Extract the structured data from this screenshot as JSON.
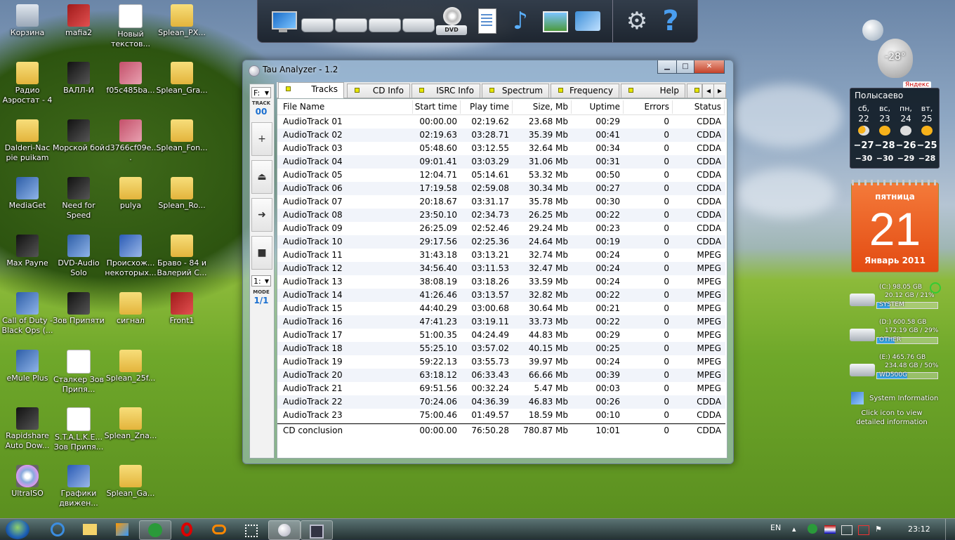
{
  "desktop": {
    "icons": [
      {
        "label": "Корзина",
        "kind": "bin"
      },
      {
        "label": "mafia2",
        "kind": "red"
      },
      {
        "label": "Новый текстов...",
        "kind": "doc"
      },
      {
        "label": "Splean_PX...",
        "kind": "folder"
      },
      {
        "label": "Радио Аэростат - 4",
        "kind": "folder"
      },
      {
        "label": "ВАЛЛ-И",
        "kind": "dark"
      },
      {
        "label": "f05c485ba...",
        "kind": "img"
      },
      {
        "label": "Splean_Gra...",
        "kind": "folder"
      },
      {
        "label": "Dalderi-Nac pie puikam",
        "kind": "folder"
      },
      {
        "label": "Морской бой",
        "kind": "dark"
      },
      {
        "label": "d3766cf09e...",
        "kind": "img"
      },
      {
        "label": "Splean_Fon...",
        "kind": "folder"
      },
      {
        "label": "MediaGet",
        "kind": "exe"
      },
      {
        "label": "Need for Speed",
        "kind": "dark"
      },
      {
        "label": "pulya",
        "kind": "folder"
      },
      {
        "label": "Splean_Ro...",
        "kind": "folder"
      },
      {
        "label": "Max Payne",
        "kind": "dark"
      },
      {
        "label": "DVD-Audio Solo",
        "kind": "exe"
      },
      {
        "label": "Происхож... некоторых...",
        "kind": "word"
      },
      {
        "label": "Браво - 84 и Валерий С...",
        "kind": "folder"
      },
      {
        "label": "Call of Duty - Black Ops (...",
        "kind": "exe"
      },
      {
        "label": "Зов Припяти",
        "kind": "dark"
      },
      {
        "label": "сигнал",
        "kind": "folder"
      },
      {
        "label": "Front1",
        "kind": "red"
      },
      {
        "label": "eMule Plus",
        "kind": "exe"
      },
      {
        "label": "Сталкер Зов Припя...",
        "kind": "doc"
      },
      {
        "label": "Splean_25f...",
        "kind": "folder"
      },
      {
        "label": "",
        "kind": "none"
      },
      {
        "label": "Rapidshare Auto Dow...",
        "kind": "dark"
      },
      {
        "label": "S.T.A.L.K.E... Зов Припя...",
        "kind": "doc"
      },
      {
        "label": "Splean_Zna...",
        "kind": "folder"
      },
      {
        "label": "",
        "kind": "none"
      },
      {
        "label": "UltraISO",
        "kind": "disc"
      },
      {
        "label": "Графики движен...",
        "kind": "word"
      },
      {
        "label": "Splean_Ga...",
        "kind": "folder"
      }
    ]
  },
  "toolbar": {
    "icons": [
      "monitor-icon",
      "drive-icon",
      "drive-icon",
      "drive-icon",
      "drive-icon",
      "dvd-drive-icon",
      "document-icon",
      "music-note-icon",
      "picture-icon",
      "network-icon",
      "gear-icon",
      "help-icon"
    ],
    "dvd_label": "DVD",
    "help_label": "?"
  },
  "window": {
    "title": "Tau Analyzer - 1.2",
    "controls": {
      "minimize": "▁",
      "maximize": "□",
      "close": "✕"
    },
    "side": {
      "drive_select": "F:",
      "track_label": "TRACK",
      "track_value": "00",
      "buttons": [
        "+",
        "⏏",
        "➜",
        "■"
      ],
      "mode_select": "1:",
      "mode_label": "MODE",
      "mode_value": "1/1"
    },
    "tabs": [
      "Tracks",
      "CD Info",
      "ISRC Info",
      "Spectrum",
      "Frequency",
      "Help"
    ],
    "tab_scroll": {
      "left": "◂",
      "right": "▸"
    },
    "columns": [
      "File Name",
      "Start time",
      "Play time",
      "Size, Mb",
      "Uptime",
      "Errors",
      "Status"
    ],
    "rows": [
      [
        "AudioTrack 01",
        "00:00.00",
        "02:19.62",
        "23.68 Mb",
        "00:29",
        "0",
        "CDDA"
      ],
      [
        "AudioTrack 02",
        "02:19.63",
        "03:28.71",
        "35.39 Mb",
        "00:41",
        "0",
        "CDDA"
      ],
      [
        "AudioTrack 03",
        "05:48.60",
        "03:12.55",
        "32.64 Mb",
        "00:34",
        "0",
        "CDDA"
      ],
      [
        "AudioTrack 04",
        "09:01.41",
        "03:03.29",
        "31.06 Mb",
        "00:31",
        "0",
        "CDDA"
      ],
      [
        "AudioTrack 05",
        "12:04.71",
        "05:14.61",
        "53.32 Mb",
        "00:50",
        "0",
        "CDDA"
      ],
      [
        "AudioTrack 06",
        "17:19.58",
        "02:59.08",
        "30.34 Mb",
        "00:27",
        "0",
        "CDDA"
      ],
      [
        "AudioTrack 07",
        "20:18.67",
        "03:31.17",
        "35.78 Mb",
        "00:30",
        "0",
        "CDDA"
      ],
      [
        "AudioTrack 08",
        "23:50.10",
        "02:34.73",
        "26.25 Mb",
        "00:22",
        "0",
        "CDDA"
      ],
      [
        "AudioTrack 09",
        "26:25.09",
        "02:52.46",
        "29.24 Mb",
        "00:23",
        "0",
        "CDDA"
      ],
      [
        "AudioTrack 10",
        "29:17.56",
        "02:25.36",
        "24.64 Mb",
        "00:19",
        "0",
        "CDDA"
      ],
      [
        "AudioTrack 11",
        "31:43.18",
        "03:13.21",
        "32.74 Mb",
        "00:24",
        "0",
        "MPEG"
      ],
      [
        "AudioTrack 12",
        "34:56.40",
        "03:11.53",
        "32.47 Mb",
        "00:24",
        "0",
        "MPEG"
      ],
      [
        "AudioTrack 13",
        "38:08.19",
        "03:18.26",
        "33.59 Mb",
        "00:24",
        "0",
        "MPEG"
      ],
      [
        "AudioTrack 14",
        "41:26.46",
        "03:13.57",
        "32.82 Mb",
        "00:22",
        "0",
        "MPEG"
      ],
      [
        "AudioTrack 15",
        "44:40.29",
        "03:00.68",
        "30.64 Mb",
        "00:21",
        "0",
        "MPEG"
      ],
      [
        "AudioTrack 16",
        "47:41.23",
        "03:19.11",
        "33.73 Mb",
        "00:22",
        "0",
        "MPEG"
      ],
      [
        "AudioTrack 17",
        "51:00.35",
        "04:24.49",
        "44.83 Mb",
        "00:29",
        "0",
        "MPEG"
      ],
      [
        "AudioTrack 18",
        "55:25.10",
        "03:57.02",
        "40.15 Mb",
        "00:25",
        "0",
        "MPEG"
      ],
      [
        "AudioTrack 19",
        "59:22.13",
        "03:55.73",
        "39.97 Mb",
        "00:24",
        "0",
        "MPEG"
      ],
      [
        "AudioTrack 20",
        "63:18.12",
        "06:33.43",
        "66.66 Mb",
        "00:39",
        "0",
        "MPEG"
      ],
      [
        "AudioTrack 21",
        "69:51.56",
        "00:32.24",
        "5.47 Mb",
        "00:03",
        "0",
        "MPEG"
      ],
      [
        "AudioTrack 22",
        "70:24.06",
        "04:36.39",
        "46.83 Mb",
        "00:26",
        "0",
        "CDDA"
      ],
      [
        "AudioTrack 23",
        "75:00.46",
        "01:49.57",
        "18.59 Mb",
        "00:10",
        "0",
        "CDDA"
      ]
    ],
    "summary": [
      "CD conclusion",
      "00:00.00",
      "76:50.28",
      "780.87 Mb",
      "10:01",
      "0",
      "CDDA"
    ]
  },
  "gadgets": {
    "balloon_temp": "-28°",
    "yandex": "Яндекс",
    "weather": {
      "city": "Полысаево",
      "days": [
        {
          "dow": "сб,",
          "date": "22",
          "icon": "partly-cloudy-icon",
          "hi": "−27",
          "lo": "−30"
        },
        {
          "dow": "вс,",
          "date": "23",
          "icon": "sun-icon",
          "hi": "−28",
          "lo": "−30"
        },
        {
          "dow": "пн,",
          "date": "24",
          "icon": "cloud-icon",
          "hi": "−26",
          "lo": "−29"
        },
        {
          "dow": "вт,",
          "date": "25",
          "icon": "sun-icon",
          "hi": "−25",
          "lo": "−28"
        }
      ]
    },
    "calendar": {
      "weekday": "пятница",
      "day": "21",
      "month_year": "Январь 2011"
    },
    "drives": [
      {
        "letter": "(C:)",
        "total": "98.05 GB",
        "used": "20.12 GB / 21%",
        "name": "SYSTEM",
        "fill": 0.21
      },
      {
        "letter": "(D:)",
        "total": "600.58 GB",
        "used": "172.19 GB / 29%",
        "name": "OTHER",
        "fill": 0.29
      },
      {
        "letter": "(E:)",
        "total": "465.76 GB",
        "used": "234.48 GB / 50%",
        "name": "WD500G",
        "fill": 0.5
      }
    ],
    "sysinfo_title": "System Information",
    "sysinfo_hint": "Click icon to view detailed information"
  },
  "taskbar": {
    "buttons": [
      "start-orb",
      "ie-icon",
      "explorer-icon",
      "media-icon",
      "utorrent-icon",
      "opera-icon",
      "link-icon",
      "grid-icon",
      "tau-analyzer-icon",
      "media-player-icon"
    ],
    "lang": "EN",
    "time": "23:12"
  }
}
